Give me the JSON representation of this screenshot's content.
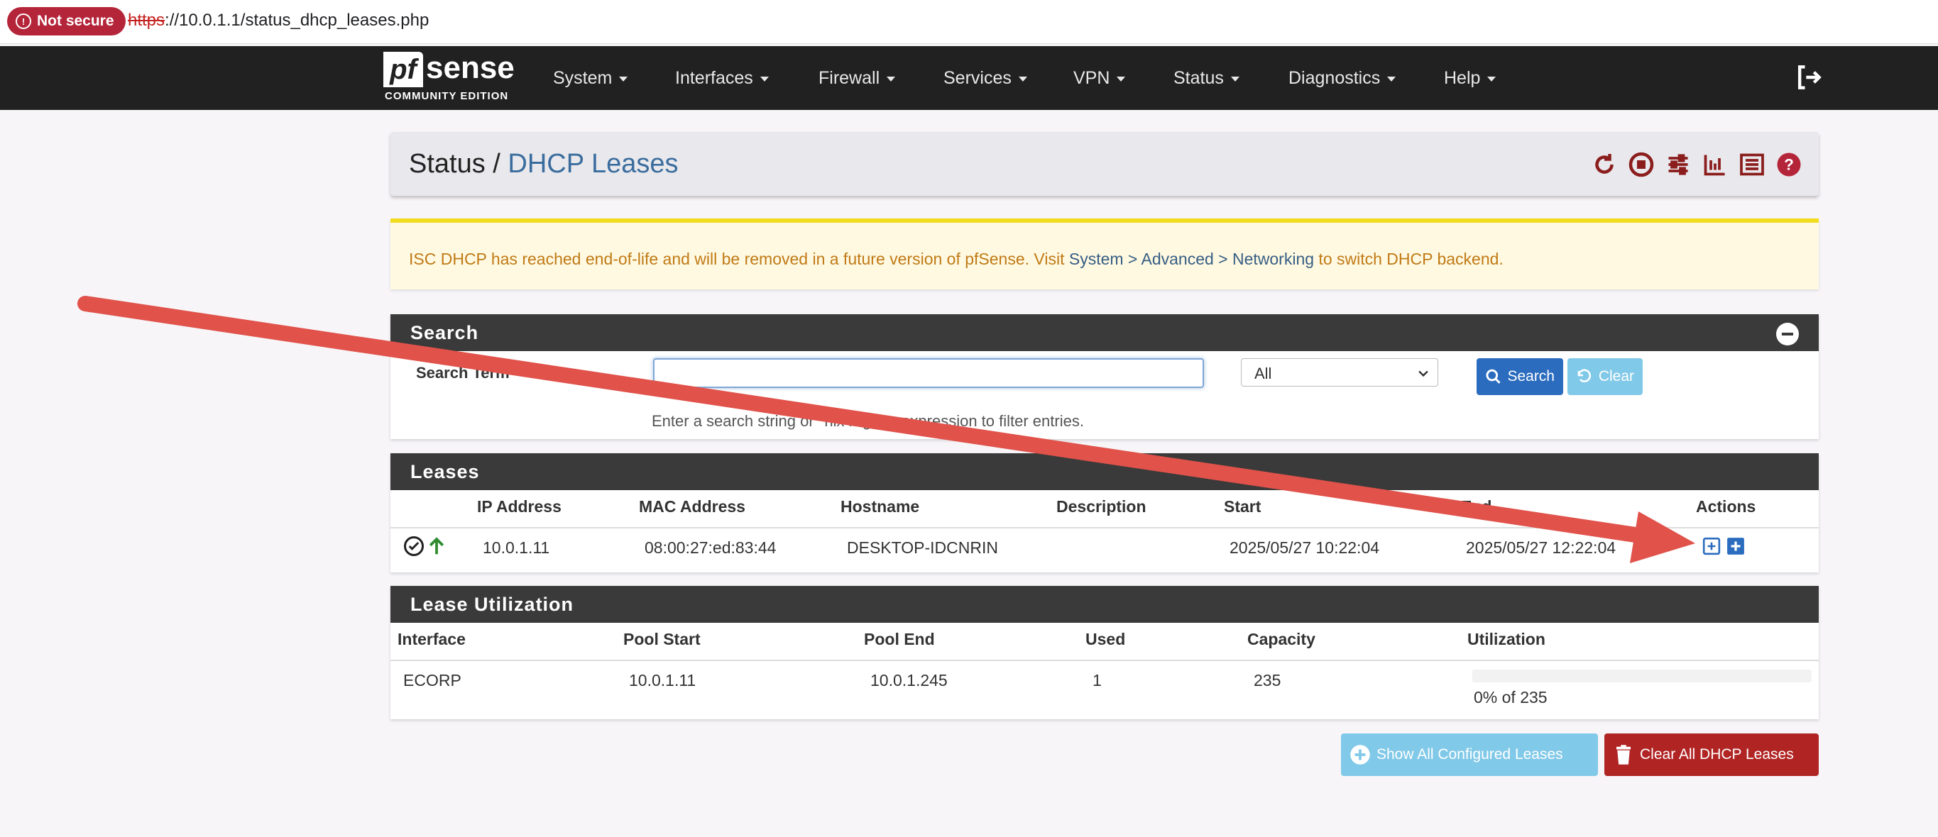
{
  "browser": {
    "security_badge": "Not secure",
    "url_scheme": "https",
    "url_rest": "://10.0.1.1/status_dhcp_leases.php"
  },
  "nav": {
    "logo_text": "sense",
    "logo_pf": "pf",
    "logo_sub": "COMMUNITY EDITION",
    "menu": [
      "System",
      "Interfaces",
      "Firewall",
      "Services",
      "VPN",
      "Status",
      "Diagnostics",
      "Help"
    ]
  },
  "page": {
    "crumb_parent": "Status /",
    "crumb_current": "DHCP Leases"
  },
  "alert": {
    "text_before": "ISC DHCP has reached end-of-life and will be removed in a future version of pfSense. Visit ",
    "link_text": "System > Advanced > Networking",
    "text_after": " to switch DHCP backend."
  },
  "search": {
    "title": "Search",
    "term_label": "Search Term",
    "term_value": "",
    "filter_selected": "All",
    "search_button": "Search",
    "clear_button": "Clear",
    "help_text": "Enter a search string or *nix regular expression to filter entries."
  },
  "leases": {
    "title": "Leases",
    "columns": [
      "IP Address",
      "MAC Address",
      "Hostname",
      "Description",
      "Start",
      "End",
      "Actions"
    ],
    "rows": [
      {
        "ip": "10.0.1.11",
        "mac": "08:00:27:ed:83:44",
        "hostname": "DESKTOP-IDCNRIN",
        "description": "",
        "start": "2025/05/27 10:22:04",
        "end": "2025/05/27 12:22:04"
      }
    ]
  },
  "utilization": {
    "title": "Lease Utilization",
    "columns": [
      "Interface",
      "Pool Start",
      "Pool End",
      "Used",
      "Capacity",
      "Utilization"
    ],
    "rows": [
      {
        "interface": "ECORP",
        "pool_start": "10.0.1.11",
        "pool_end": "10.0.1.245",
        "used": "1",
        "capacity": "235",
        "utilization_text": "0% of 235",
        "utilization_fraction": 0.0
      }
    ]
  },
  "footer_buttons": {
    "show_all": "Show All Configured Leases",
    "clear_all": "Clear All DHCP Leases"
  },
  "colors": {
    "navbar": "#212121",
    "panel_header": "#3a3a3a",
    "primary": "#2b6cbf",
    "info": "#81c9e8",
    "danger": "#b12424",
    "annotation_arrow": "#e0524a"
  }
}
